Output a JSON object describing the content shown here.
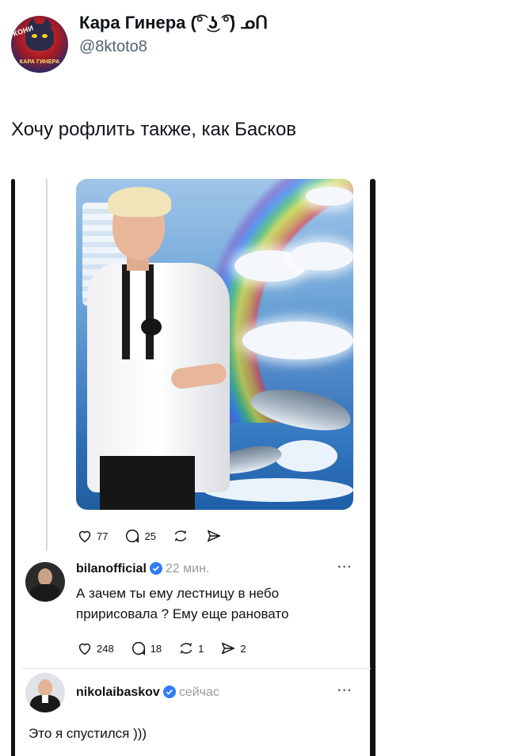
{
  "tweet": {
    "display_name": "Кара Гинера (͡° ͜ʖ ͡°) ᓄᑎ",
    "handle": "@8ktoto8",
    "text": "Хочу рофлить также, как Басков",
    "avatar_tag_top": "КОНИ",
    "avatar_tag_bottom": "КАРА ГИНЕРА"
  },
  "embedded_post": {
    "likes": "77",
    "comments": "25"
  },
  "replies": [
    {
      "username": "bilanofficial",
      "time": "22 мин.",
      "text_line1": "А зачем ты ему лестницу в небо",
      "text_line2": "пририсовала ? Ему еще рановато",
      "likes": "248",
      "comments": "18",
      "reposts": "1",
      "shares": "2",
      "more": "···"
    },
    {
      "username": "nikolaibaskov",
      "time": "сейчас",
      "text": "Это я спустился )))",
      "more": "···"
    }
  ],
  "colors": {
    "verified": "#2f7cf6",
    "muted": "#536471"
  }
}
